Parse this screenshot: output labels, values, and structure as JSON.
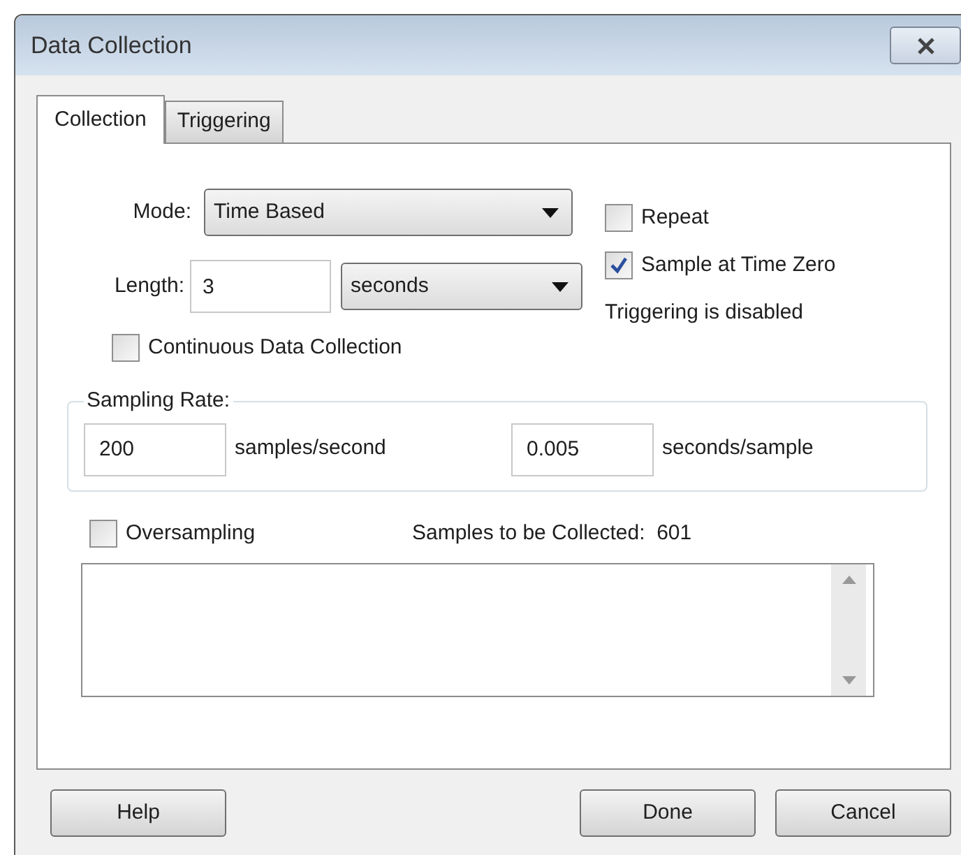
{
  "window": {
    "title": "Data Collection"
  },
  "tabs": [
    {
      "label": "Collection",
      "selected": true
    },
    {
      "label": "Triggering",
      "selected": false
    }
  ],
  "mode": {
    "label": "Mode:",
    "value": "Time Based"
  },
  "length": {
    "label": "Length:",
    "value": "3",
    "unit": "seconds"
  },
  "options": [
    {
      "label": "Repeat",
      "checked": false
    },
    {
      "label": "Sample at Time Zero",
      "checked": true
    }
  ],
  "triggering_status": "Triggering is disabled",
  "continuous": {
    "label": "Continuous Data Collection",
    "checked": false
  },
  "sampling_rate": {
    "title": "Sampling Rate:",
    "fields": [
      {
        "value": "200",
        "unit": "samples/second"
      },
      {
        "value": "0.005",
        "unit": "seconds/sample"
      }
    ]
  },
  "oversampling": {
    "label": "Oversampling",
    "checked": false
  },
  "samples_collected": {
    "label": "Samples to be Collected:",
    "value": "601"
  },
  "buttons": [
    {
      "label": "Help"
    },
    {
      "label": "Done"
    },
    {
      "label": "Cancel"
    }
  ]
}
